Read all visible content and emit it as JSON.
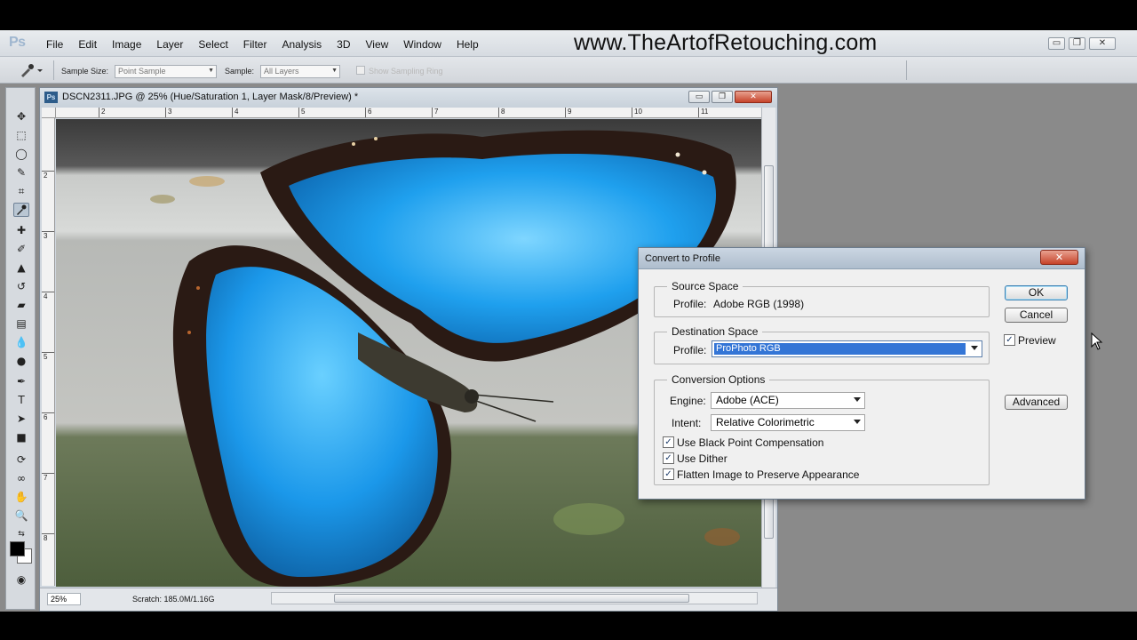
{
  "app": {
    "logo": "Ps",
    "watermark": "www.TheArtofRetouching.com",
    "window_controls": [
      "▭",
      "❐",
      "✕"
    ]
  },
  "menu": [
    "File",
    "Edit",
    "Image",
    "Layer",
    "Select",
    "Filter",
    "Analysis",
    "3D",
    "View",
    "Window",
    "Help"
  ],
  "options_bar": {
    "sample_size_label": "Sample Size:",
    "sample_size_value": "Point Sample",
    "sample_label": "Sample:",
    "sample_value": "All Layers",
    "show_sampling_ring": "Show Sampling Ring"
  },
  "document": {
    "logo": "Ps",
    "title": "DSCN2311.JPG @ 25% (Hue/Saturation 1, Layer Mask/8/Preview) *",
    "controls": [
      "▭",
      "❐",
      "✕"
    ],
    "ruler_h": [
      "2",
      "3",
      "4",
      "5",
      "6",
      "7",
      "8",
      "9",
      "10",
      "11"
    ],
    "ruler_v": [
      "2",
      "3",
      "4",
      "5",
      "6",
      "7",
      "8"
    ],
    "zoom": "25%",
    "scratch": "Scratch: 185.0M/1.16G"
  },
  "dialog": {
    "title": "Convert to Profile",
    "close": "✕",
    "source_space": {
      "legend": "Source Space",
      "profile_label": "Profile:",
      "profile_value": "Adobe RGB (1998)"
    },
    "destination_space": {
      "legend": "Destination Space",
      "profile_label": "Profile:",
      "profile_value": "ProPhoto RGB"
    },
    "conversion_options": {
      "legend": "Conversion Options",
      "engine_label": "Engine:",
      "engine_value": "Adobe (ACE)",
      "intent_label": "Intent:",
      "intent_value": "Relative Colorimetric",
      "use_black_point": "Use Black Point Compensation",
      "use_dither": "Use Dither",
      "flatten": "Flatten Image to Preserve Appearance",
      "check_mark": "✓"
    },
    "buttons": {
      "ok": "OK",
      "cancel": "Cancel",
      "advanced": "Advanced"
    },
    "preview_label": "Preview",
    "preview_check": "✓"
  },
  "colors": {
    "accent_blue": "#3375d6",
    "butterfly_blue": "#1fa0ee",
    "close_red": "#c6432a"
  }
}
